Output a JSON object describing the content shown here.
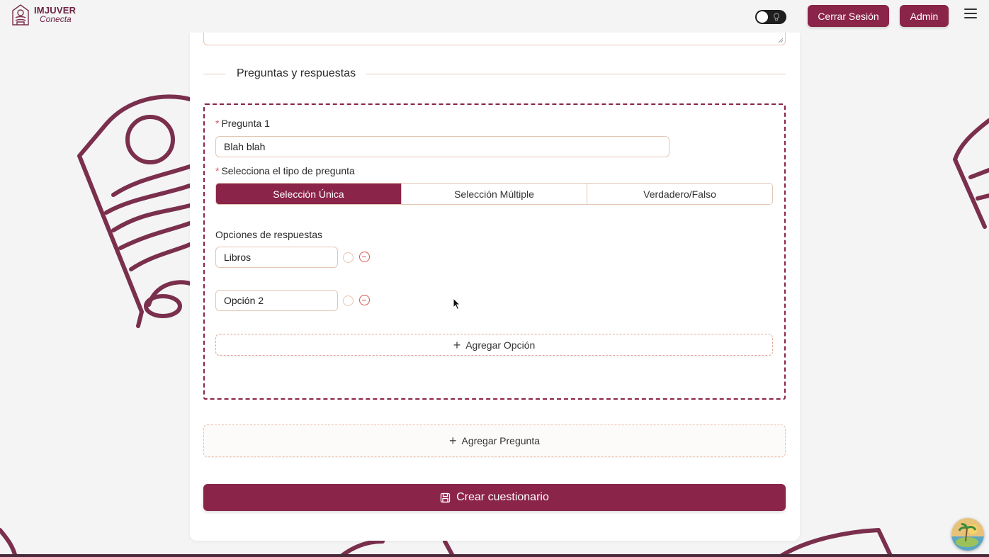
{
  "header": {
    "logo_title": "IMJUVER",
    "logo_subtitle": "Conecta",
    "logout_label": "Cerrar Sesión",
    "admin_label": "Admin"
  },
  "form": {
    "section_title": "Preguntas y respuestas",
    "question": {
      "label": "Pregunta 1",
      "value": "Blah blah",
      "type_label": "Selecciona el tipo de pregunta",
      "types": [
        "Selección Única",
        "Selección Múltiple",
        "Verdadero/Falso"
      ],
      "selected_type": "Selección Única",
      "options_label": "Opciones de respuestas",
      "options": [
        "Libros",
        "Opción 2"
      ],
      "add_option_label": "Agregar Opción"
    },
    "add_question_label": "Agregar Pregunta",
    "submit_label": "Crear cuestionario"
  },
  "colors": {
    "primary": "#8a2448",
    "background": "#f4f4f4",
    "border_accent": "#e2c6b5"
  }
}
